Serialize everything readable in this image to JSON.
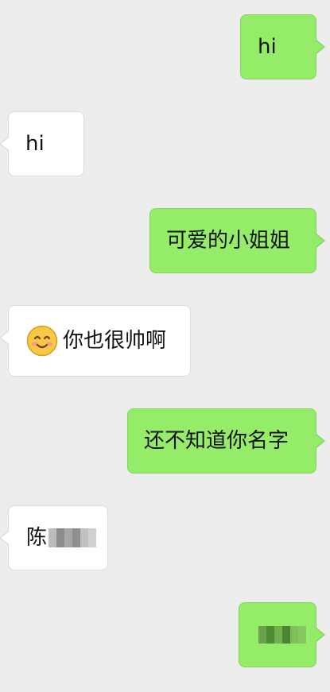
{
  "messages": [
    {
      "side": "sent",
      "text": "hi"
    },
    {
      "side": "received",
      "text": "hi"
    },
    {
      "side": "sent",
      "text": "可爱的小姐姐"
    },
    {
      "side": "received",
      "emoji": "smiling-face-icon",
      "text": "你也很帅啊"
    },
    {
      "side": "sent",
      "text": "还不知道你名字"
    },
    {
      "side": "received",
      "text": "陈",
      "obscured": true
    },
    {
      "side": "sent",
      "text": "",
      "obscured": true
    }
  ],
  "colors": {
    "background": "#ededed",
    "sent_bubble": "#95ec69",
    "received_bubble": "#ffffff",
    "text": "#111111"
  }
}
